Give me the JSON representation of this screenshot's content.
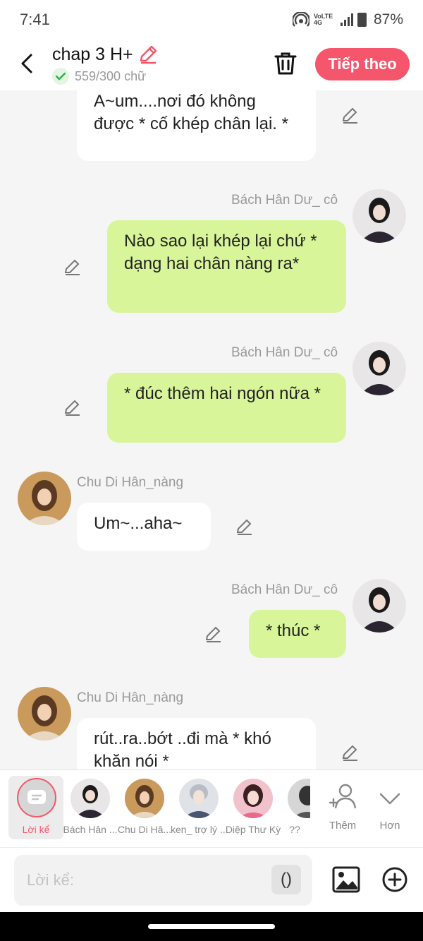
{
  "status": {
    "time": "7:41",
    "network": "VoLTE 4G",
    "battery": "87%"
  },
  "header": {
    "title": "chap 3 H+",
    "word_count": "559/300 chữ",
    "next_label": "Tiếp theo"
  },
  "messages": [
    {
      "side": "left",
      "text": "A~um....nơi đó không được * cố khép chân lại. *"
    },
    {
      "side": "right",
      "sender": "Bách Hân Dư_ cô",
      "text": "Nào sao lại khép lại chứ * dạng hai chân nàng ra*"
    },
    {
      "side": "right",
      "sender": "Bách Hân Dư_ cô",
      "text": "* đúc thêm hai ngón nữa *"
    },
    {
      "side": "left",
      "sender": "Chu Di Hân_nàng",
      "text": "Um~...aha~"
    },
    {
      "side": "right",
      "sender": "Bách Hân Dư_ cô",
      "text": "* thúc *"
    },
    {
      "side": "left",
      "sender": "Chu Di Hân_nàng",
      "text": "rút..ra..bớt ..đi mà * khó khăn nói *"
    }
  ],
  "cast": {
    "narrator_label": "Lời kể",
    "characters": [
      "Bách Hân ...",
      "Chu Di Hâ...",
      "ken_ trợ lý ...",
      "Diệp Thư Kỳ",
      "??"
    ],
    "add_label": "Thêm",
    "more_label": "Hơn"
  },
  "input": {
    "placeholder": "Lời kể:",
    "paren_label": "()"
  },
  "colors": {
    "accent": "#f5566b",
    "right_bubble": "#d8f59a",
    "left_bubble": "#ffffff"
  }
}
